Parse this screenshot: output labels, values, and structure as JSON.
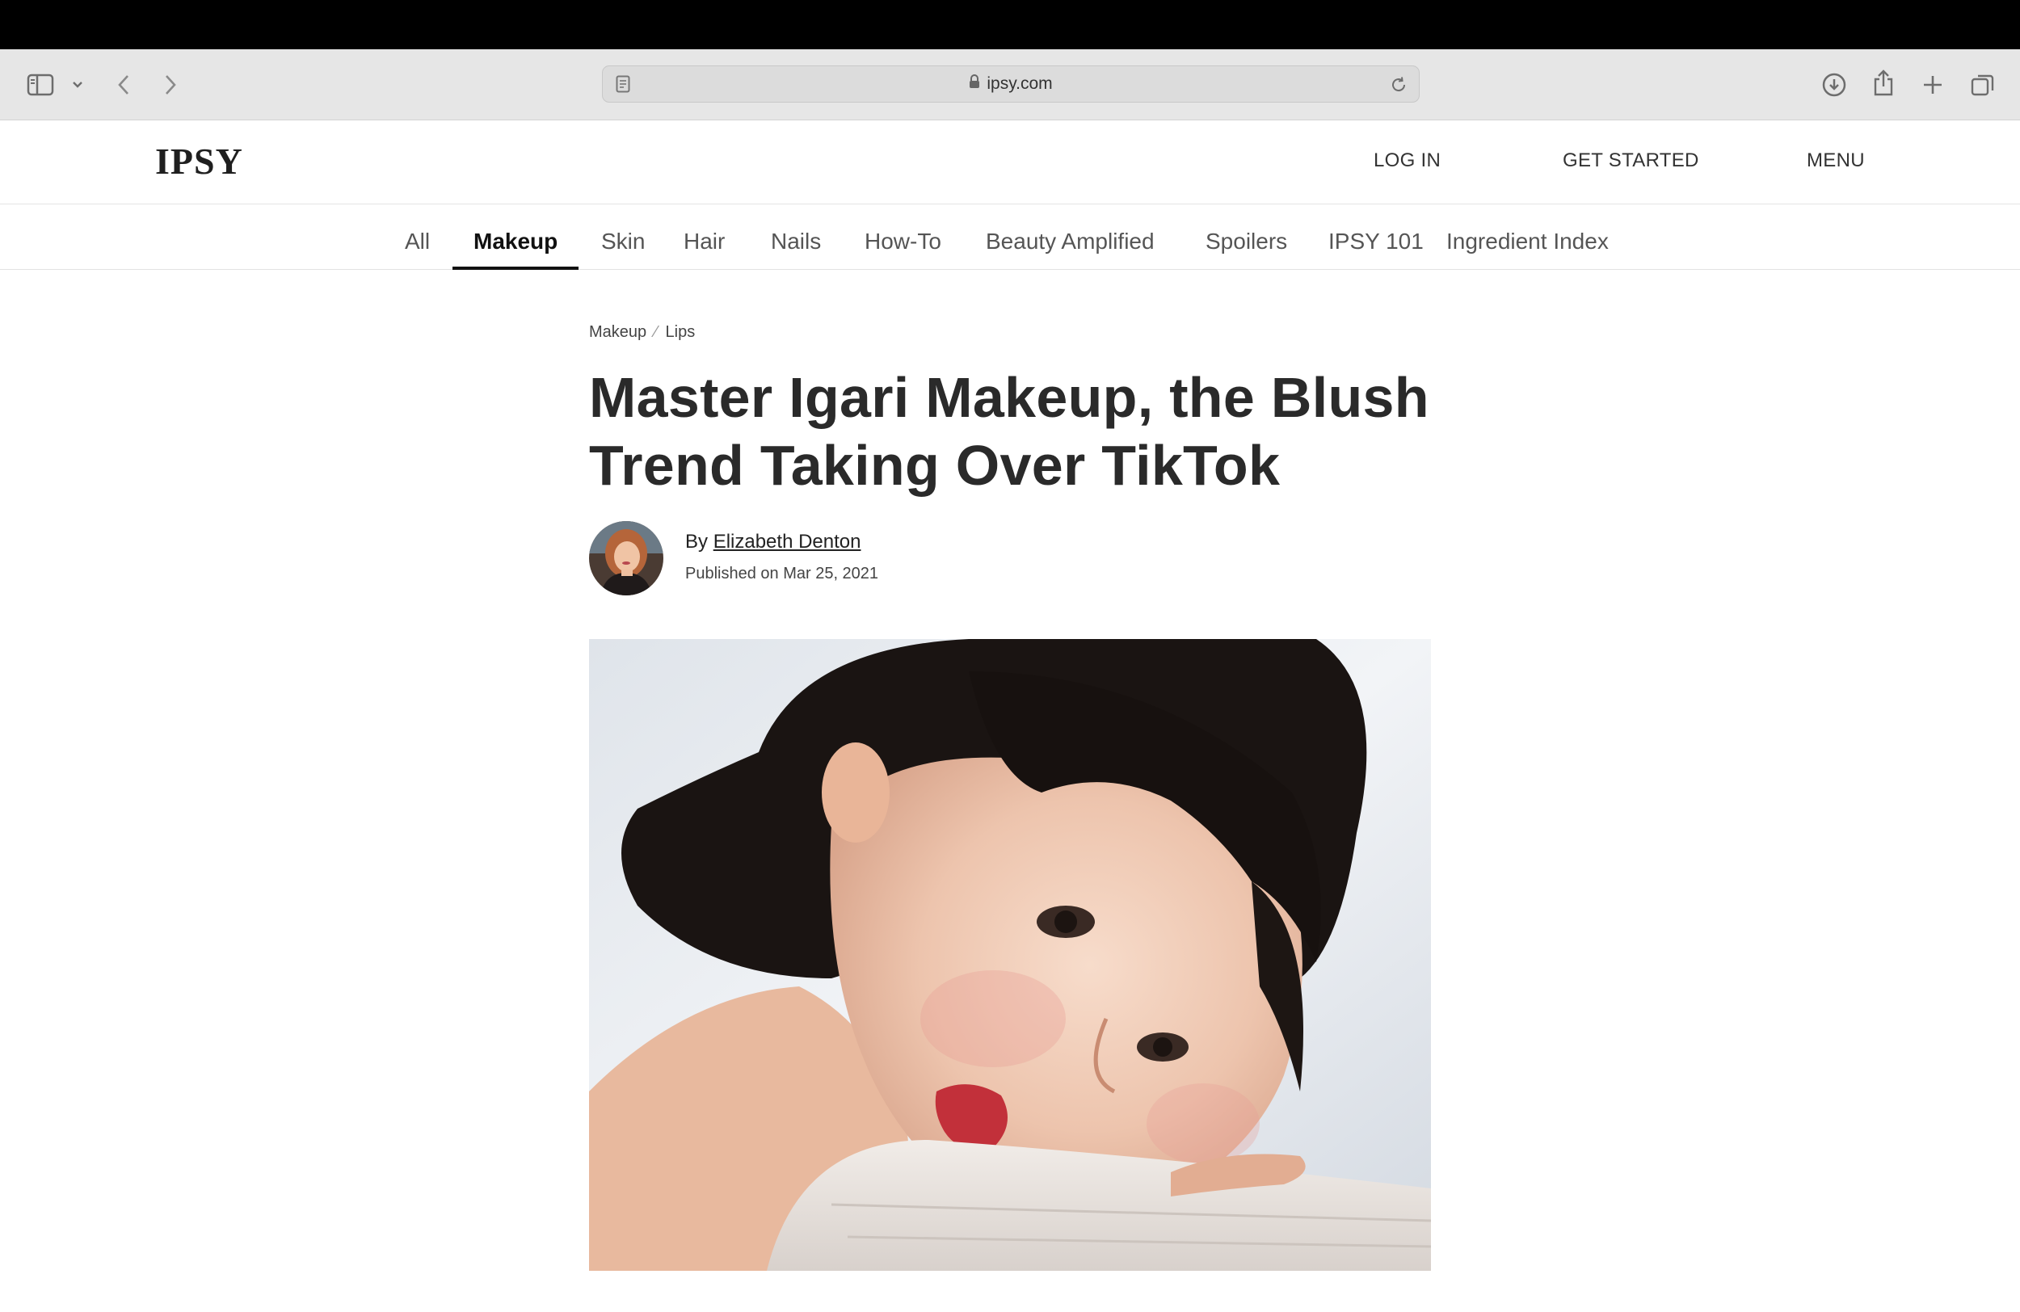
{
  "browser": {
    "url": "ipsy.com"
  },
  "header": {
    "logo": "IPSY",
    "login": "LOG IN",
    "get_started": "GET STARTED",
    "menu": "MENU"
  },
  "nav": {
    "items": [
      {
        "label": "All",
        "active": false
      },
      {
        "label": "Makeup",
        "active": true
      },
      {
        "label": "Skin",
        "active": false
      },
      {
        "label": "Hair",
        "active": false
      },
      {
        "label": "Nails",
        "active": false
      },
      {
        "label": "How-To",
        "active": false
      },
      {
        "label": "Beauty Amplified",
        "active": false
      },
      {
        "label": "Spoilers",
        "active": false
      },
      {
        "label": "IPSY 101",
        "active": false
      },
      {
        "label": "Ingredient Index",
        "active": false
      }
    ]
  },
  "article": {
    "breadcrumb": [
      "Makeup",
      "Lips"
    ],
    "breadcrumb_sep": "⁄",
    "title": "Master Igari Makeup, the Blush Trend Taking Over TikTok",
    "by_prefix": "By",
    "author": "Elizabeth Denton",
    "published": "Published on Mar 25, 2021"
  },
  "colors": {
    "os_bar": "#000000",
    "toolbar": "#e6e6e6",
    "active_nav": "#111111",
    "lip": "#c2303a"
  }
}
